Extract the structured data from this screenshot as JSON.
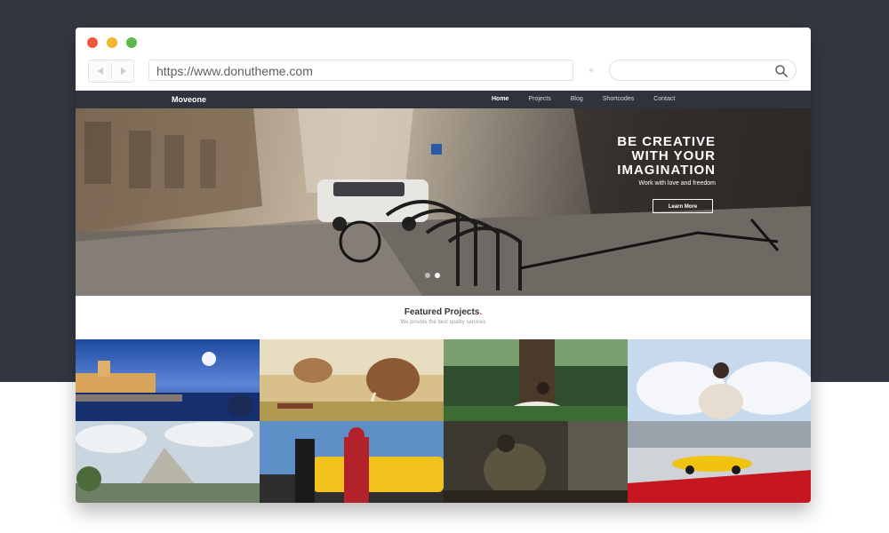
{
  "browser": {
    "url": "https://www.donutheme.com",
    "search_placeholder": ""
  },
  "site": {
    "brand": "Moveone",
    "menu": [
      "Home",
      "Projects",
      "Blog",
      "Shortcodes",
      "Contact"
    ],
    "active_menu": "Home"
  },
  "hero": {
    "title_lines": [
      "BE CREATIVE",
      "WITH YOUR",
      "IMAGINATION"
    ],
    "subtitle": "Work with love and freedom",
    "button_label": "Learn More",
    "slides": 2,
    "active_slide": 1
  },
  "featured": {
    "title": "Featured Projects",
    "accent_mark": ".",
    "subtitle": "We provide the best quality services"
  },
  "colors": {
    "page_dark": "#343741",
    "nav_bg": "#2e333d",
    "accent": "#e7343f",
    "dot_red": "#f0573f",
    "dot_yellow": "#f5b62e",
    "dot_green": "#5fb84a"
  }
}
